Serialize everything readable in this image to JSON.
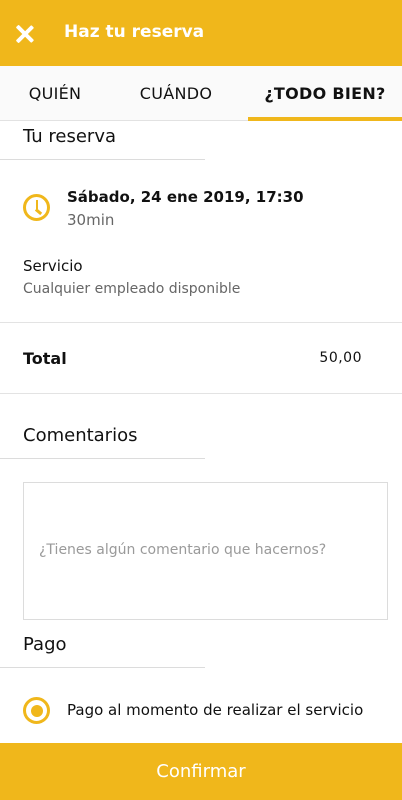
{
  "header": {
    "title": "Haz tu reserva",
    "close_icon": "close-icon",
    "background_color": "#F0B71B"
  },
  "tabs": [
    {
      "label": "QUIÉN",
      "active": false
    },
    {
      "label": "CUÁNDO",
      "active": false
    },
    {
      "label": "¿TODO BIEN?",
      "active": true
    }
  ],
  "booking": {
    "section_title": "Tu reserva",
    "clock_icon": "clock-icon",
    "datetime": "Sábado, 24 ene 2019, 17:30",
    "duration": "30min",
    "service_label": "Servicio",
    "service_value": "Cualquier empleado disponible"
  },
  "total": {
    "label": "Total",
    "value": "50,00"
  },
  "comments": {
    "section_title": "Comentarios",
    "placeholder": "¿Tienes algún comentario que hacernos?"
  },
  "payment": {
    "section_title": "Pago",
    "option_label": "Pago al momento de realizar el servicio",
    "selected": true
  },
  "footer": {
    "confirm_label": "Confirmar"
  },
  "accent_color": "#F0B71B"
}
